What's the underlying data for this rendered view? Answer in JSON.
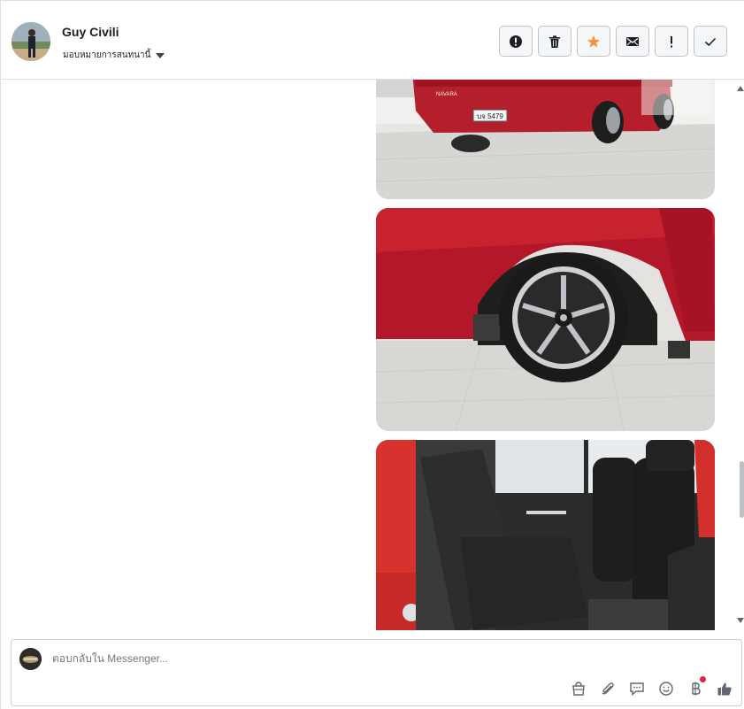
{
  "header": {
    "name": "Guy Civili",
    "assign_label": "มอบหมายการสนทนานี้",
    "actions": [
      {
        "name": "mark-spam-button",
        "icon": "exclamation-circle-icon"
      },
      {
        "name": "delete-button",
        "icon": "trash-icon"
      },
      {
        "name": "star-button",
        "icon": "star-icon"
      },
      {
        "name": "mark-unread-button",
        "icon": "envelope-icon"
      },
      {
        "name": "follow-up-button",
        "icon": "exclamation-icon"
      },
      {
        "name": "done-button",
        "icon": "check-icon"
      }
    ]
  },
  "thread": {
    "photos": [
      {
        "name": "photo-truck-rear",
        "plate_text": "บจ 5479",
        "badge_text": "NAVARA"
      },
      {
        "name": "photo-truck-wheel"
      },
      {
        "name": "photo-truck-interior"
      }
    ]
  },
  "composer": {
    "placeholder": "ตอบกลับใน Messenger...",
    "tools": [
      "shop-icon",
      "attachment-icon",
      "saved-replies-icon",
      "emoji-icon",
      "payment-baht-icon",
      "like-icon"
    ]
  },
  "colors": {
    "accent_star": "#f7923b",
    "notification_dot": "#e41e3f"
  }
}
